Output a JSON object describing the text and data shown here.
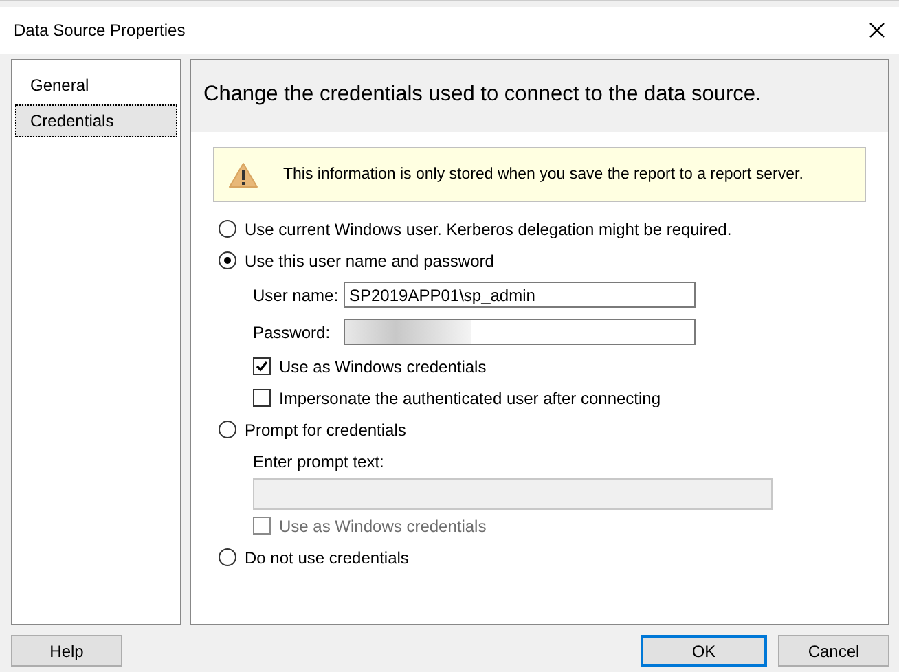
{
  "window": {
    "title": "Data Source Properties"
  },
  "sidebar": {
    "items": [
      {
        "label": "General",
        "selected": false
      },
      {
        "label": "Credentials",
        "selected": true
      }
    ]
  },
  "header": "Change the credentials used to connect to the data source.",
  "notice": "This information is only stored when you save the report to a report server.",
  "options": [
    {
      "kind": "radio",
      "label": "Use current Windows user. Kerberos delegation might be required.",
      "selected": false
    },
    {
      "kind": "radio",
      "label": "Use this user name and password",
      "selected": true
    },
    {
      "kind": "field",
      "label": "User name:",
      "value": "SP2019APP01\\sp_admin",
      "disabled": false
    },
    {
      "kind": "field",
      "label": "Password:",
      "redacted": true,
      "disabled": false
    },
    {
      "kind": "checkbox",
      "label": "Use as Windows credentials",
      "checked": true,
      "disabled": false
    },
    {
      "kind": "checkbox",
      "label": "Impersonate the authenticated user after connecting",
      "checked": false,
      "disabled": false
    },
    {
      "kind": "radio",
      "label": "Prompt for credentials",
      "selected": false
    },
    {
      "kind": "prompt",
      "label": "Enter prompt text:",
      "disabled": true
    },
    {
      "kind": "checkbox",
      "label": "Use as Windows credentials",
      "checked": false,
      "disabled": true
    },
    {
      "kind": "radio",
      "label": "Do not use credentials",
      "selected": false
    }
  ],
  "buttons": {
    "help": "Help",
    "ok": "OK",
    "cancel": "Cancel"
  }
}
